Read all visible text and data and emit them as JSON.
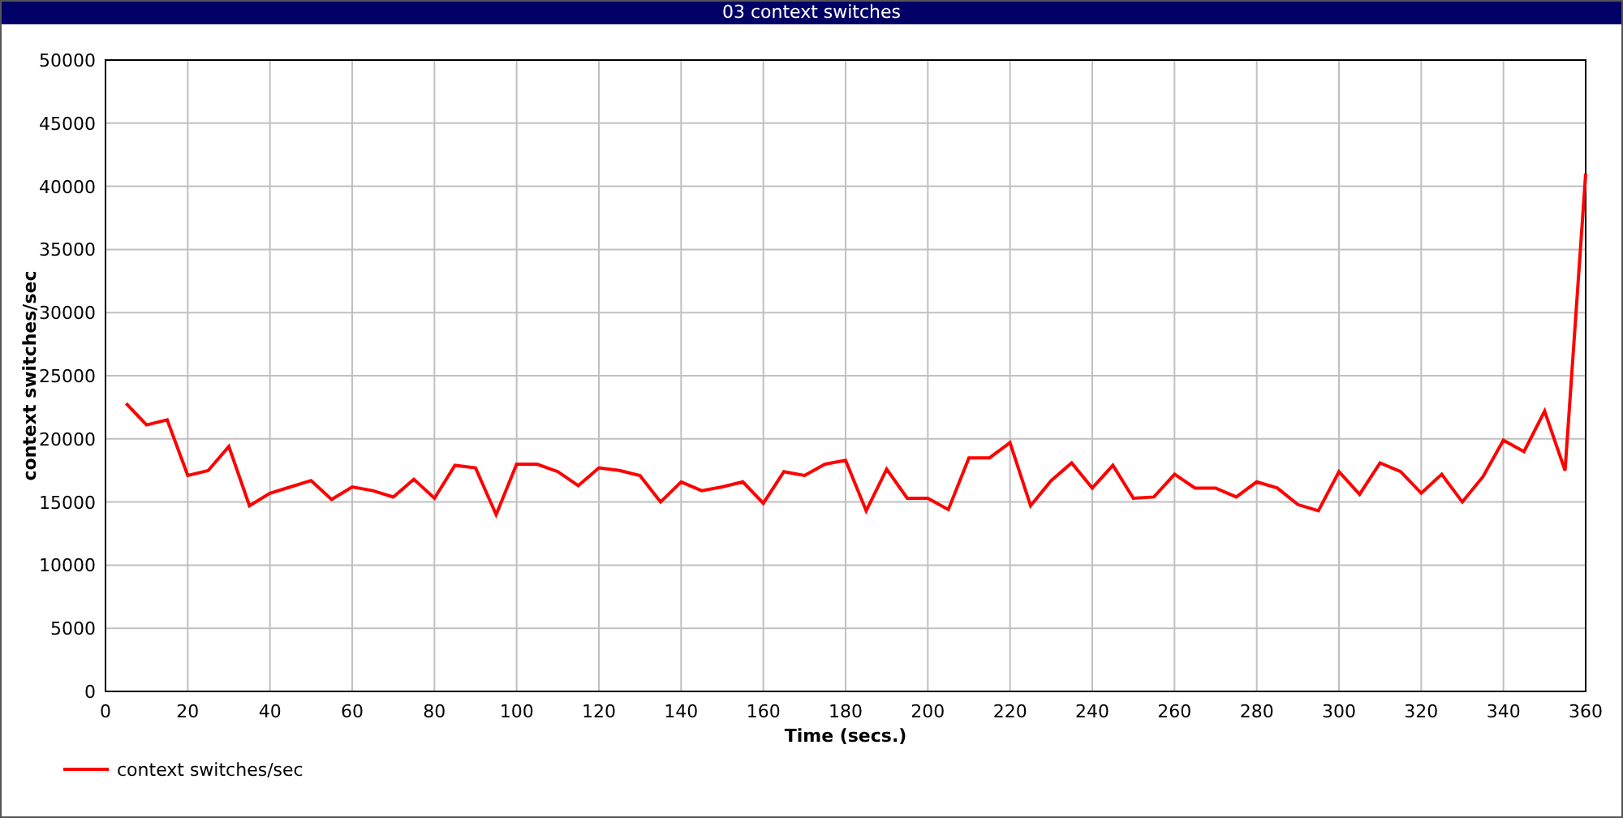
{
  "chart": {
    "chart_data": {
      "type": "line",
      "title": "03 context switches",
      "xlabel": "Time (secs.)",
      "ylabel": "context switches/sec",
      "x": [
        5,
        10,
        15,
        20,
        25,
        30,
        35,
        40,
        45,
        50,
        55,
        60,
        65,
        70,
        75,
        80,
        85,
        90,
        95,
        100,
        105,
        110,
        115,
        120,
        125,
        130,
        135,
        140,
        145,
        150,
        155,
        160,
        165,
        170,
        175,
        180,
        185,
        190,
        195,
        200,
        205,
        210,
        215,
        220,
        225,
        230,
        235,
        240,
        245,
        250,
        255,
        260,
        265,
        270,
        275,
        280,
        285,
        290,
        295,
        300,
        305,
        310,
        315,
        320,
        325,
        330,
        335,
        340,
        345,
        350,
        355,
        360
      ],
      "series": [
        {
          "name": "context switches/sec",
          "color": "#ff0000",
          "values": [
            22800,
            21100,
            21500,
            17100,
            17500,
            19400,
            14700,
            15700,
            16200,
            16700,
            15200,
            16200,
            15900,
            15400,
            16800,
            15300,
            17900,
            17700,
            14000,
            18000,
            18000,
            17400,
            16300,
            17700,
            17500,
            17100,
            15000,
            16600,
            15900,
            16200,
            16600,
            14900,
            17400,
            17100,
            18000,
            18300,
            14300,
            17600,
            15300,
            15300,
            14400,
            18500,
            18500,
            19700,
            14700,
            16700,
            18100,
            16100,
            17900,
            15300,
            15400,
            17200,
            16100,
            16100,
            15400,
            16600,
            16100,
            14800,
            14300,
            17400,
            15600,
            18100,
            17400,
            15700,
            17200,
            15000,
            17000,
            19900,
            19000,
            22200,
            17500,
            41000
          ]
        }
      ],
      "grid": true,
      "xlim": [
        0,
        360
      ],
      "ylim": [
        0,
        50000
      ],
      "xticks": [
        0,
        20,
        40,
        60,
        80,
        100,
        120,
        140,
        160,
        180,
        200,
        220,
        240,
        260,
        280,
        300,
        320,
        340,
        360
      ],
      "yticks": [
        0,
        5000,
        10000,
        15000,
        20000,
        25000,
        30000,
        35000,
        40000,
        45000,
        50000
      ]
    }
  }
}
